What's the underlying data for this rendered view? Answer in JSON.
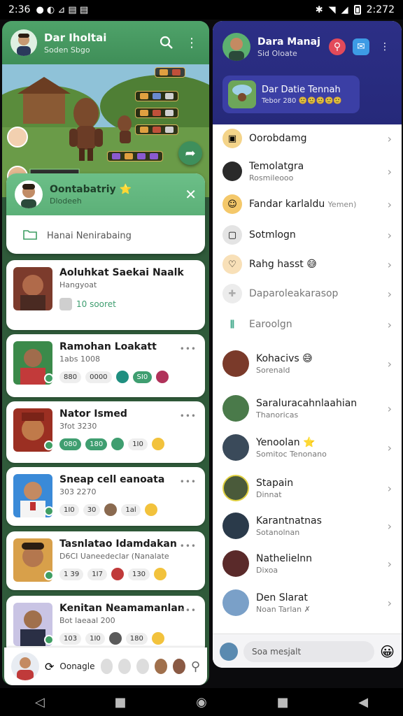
{
  "status_bar": {
    "time": "2:36",
    "right_time": "2:272"
  },
  "left": {
    "header": {
      "title": "Dar Iholtai",
      "subtitle": "Soden Sbgo"
    },
    "active_chat": {
      "name": "Oontabatriy ⭐",
      "status": "Dlodeeh",
      "input_placeholder": "Hanai Nenirabaing"
    },
    "chats": [
      {
        "name": "Aoluhkat Saekai Naalk",
        "sub": "Hangyoat",
        "count": "10 sooret"
      },
      {
        "name": "Ramohan Loakatt",
        "sub": "1abs 1008",
        "chips": [
          "880",
          "0000",
          "SI0"
        ]
      },
      {
        "name": "Nator Ismed",
        "sub": "3fot 3230",
        "chips": [
          "080",
          "180",
          "1I0"
        ]
      },
      {
        "name": "Sneap cell eanoata",
        "sub": "303 2270",
        "chips": [
          "1I0",
          "30",
          "1al"
        ]
      },
      {
        "name": "Tasnlatao Idamdakan",
        "sub": "D6CI Uaneedeclar (Nanalate",
        "chips": [
          "1 39",
          "1I7",
          "130"
        ]
      },
      {
        "name": "Kenitan Neamamanlan",
        "sub": "Bot laeaal 200",
        "chips": [
          "103",
          "1I0",
          "180"
        ]
      }
    ],
    "bottom_label": "Oonagle"
  },
  "right": {
    "header": {
      "title": "Dara Manaj",
      "subtitle": "Sid Oloate"
    },
    "group": {
      "name": "Dar Datie Tennah",
      "sub": "Tebor 280"
    },
    "items": [
      {
        "label": "Oorobdamg",
        "sub": ""
      },
      {
        "label": "Temolatgra",
        "sub": "Rosmileooo"
      },
      {
        "label": "Fandar karlaldu",
        "sub": "Yemen)"
      },
      {
        "label": "Sotmlogn",
        "sub": ""
      },
      {
        "label": "Rahg hasst 😅",
        "sub": ""
      },
      {
        "label": "Daparoleakarasop",
        "sub": ""
      },
      {
        "label": "Earoolgn",
        "sub": ""
      },
      {
        "label": "Kohacivs 😅",
        "sub": "Sorenald"
      },
      {
        "label": "Saraluracahnlaahian",
        "sub": "Thanoricas"
      },
      {
        "label": "Yenoolan ⭐",
        "sub": "Somitoc Tenonano"
      },
      {
        "label": "Stapain",
        "sub": "Dinnat"
      },
      {
        "label": "Karantnatnas",
        "sub": "Sotanolnan"
      },
      {
        "label": "Nathelielnn",
        "sub": "Dixoa"
      },
      {
        "label": "Den Slarat",
        "sub": "Noan Tarlan ✗"
      }
    ],
    "search_placeholder": "Soa mesjalt"
  }
}
